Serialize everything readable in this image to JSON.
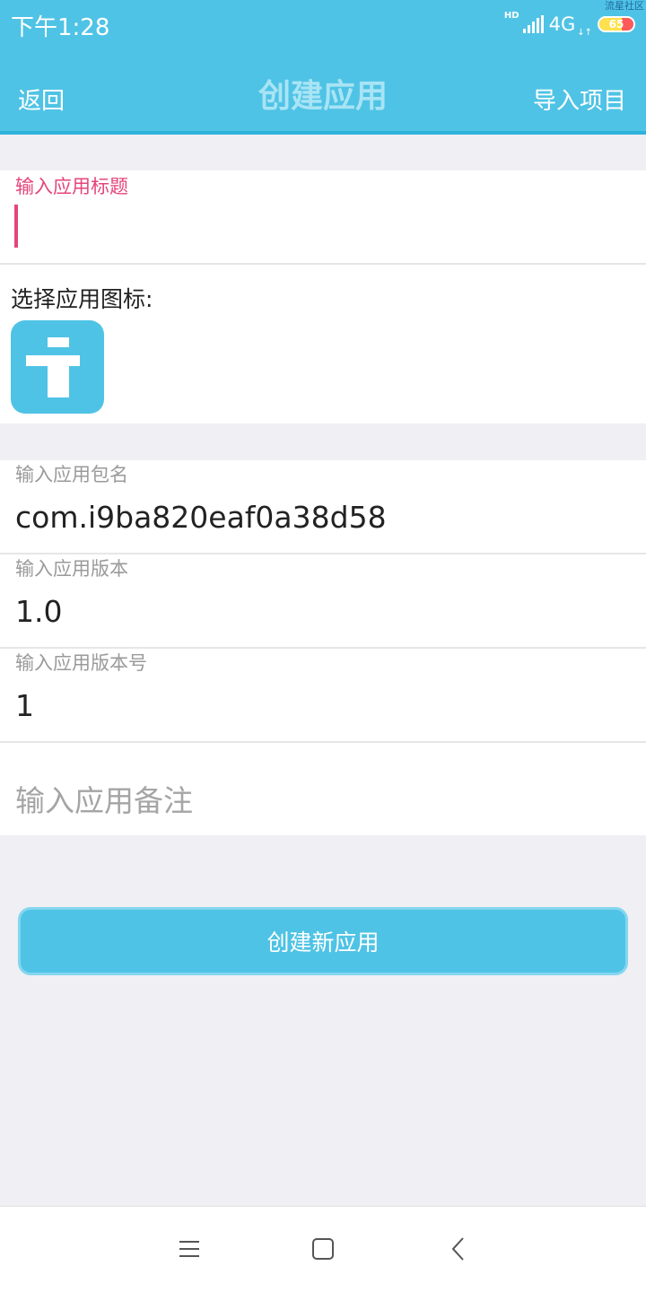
{
  "status_bar": {
    "time": "下午1:28",
    "hd": "HD",
    "network": "4G",
    "network_arrows": "↓↑",
    "battery": "65",
    "watermark": "流星社区"
  },
  "header": {
    "back_label": "返回",
    "title": "创建应用",
    "import_label": "导入项目",
    "bg_color": "#4fc3e5"
  },
  "form": {
    "title_field": {
      "label": "输入应用标题",
      "value": ""
    },
    "icon_label": "选择应用图标:",
    "package_field": {
      "label": "输入应用包名",
      "value": "com.i9ba820eaf0a38d58"
    },
    "version_field": {
      "label": "输入应用版本",
      "value": "1.0"
    },
    "version_code_field": {
      "label": "输入应用版本号",
      "value": "1"
    },
    "notes_field": {
      "placeholder": "输入应用备注"
    }
  },
  "actions": {
    "create_label": "创建新应用"
  },
  "system_nav": {
    "icons": [
      "menu-icon",
      "home-square-icon",
      "back-chevron-icon"
    ]
  }
}
